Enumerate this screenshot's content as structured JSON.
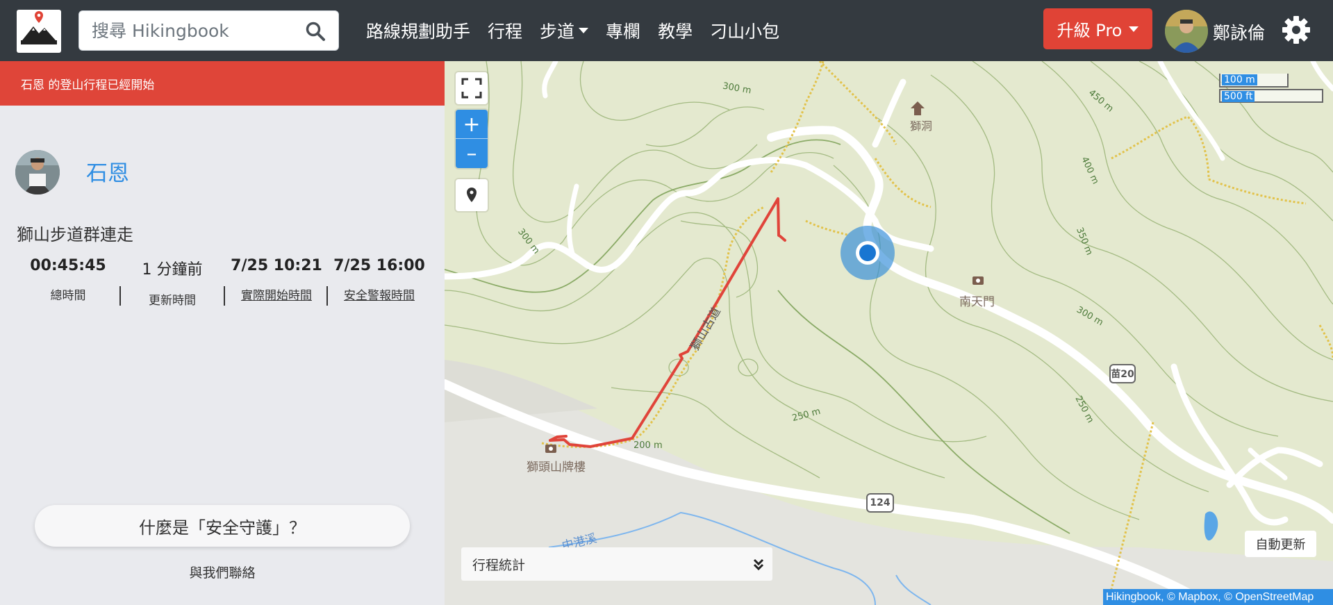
{
  "navbar": {
    "search_placeholder": "搜尋 Hikingbook",
    "links": [
      {
        "label": "路線規劃助手"
      },
      {
        "label": "行程"
      },
      {
        "label": "步道",
        "has_caret": true
      },
      {
        "label": "專欄"
      },
      {
        "label": "教學"
      },
      {
        "label": "刁山小包"
      }
    ],
    "upgrade_label": "升級 Pro",
    "user_name": "鄭詠倫",
    "icons": {
      "search": "search-icon",
      "settings": "gear-icon",
      "logo": "hikingbook-logo"
    }
  },
  "sidebar": {
    "alert_text": "石恩 的登山行程已經開始",
    "hiker_name": "石恩",
    "trail_name": "獅山步道群連走",
    "stats": [
      {
        "value": "00:45:45",
        "label": "總時間",
        "underline": false
      },
      {
        "value": "1 分鐘前",
        "label": "更新時間",
        "underline": false
      },
      {
        "value": "7/25 10:21",
        "label": "實際開始時間",
        "underline": true
      },
      {
        "value": "7/25 16:00",
        "label": "安全警報時間",
        "underline": true
      }
    ],
    "safety_button": "什麼是「安全守護」？",
    "contact_text": "與我們聯絡"
  },
  "map": {
    "zoom_in": "+",
    "zoom_out": "–",
    "scale_metric": "100 m",
    "scale_imperial": "500 ft",
    "auto_refresh": "自動更新",
    "trip_stats": "行程統計",
    "attribution": "Hikingbook, © Mapbox, © OpenStreetMap",
    "poi": {
      "cave": "獅洞",
      "south_gate": "南天門",
      "archway": "獅頭山牌樓",
      "trail": "獅山古道",
      "river": "中港溪"
    },
    "road_shields": {
      "r124": "124",
      "r20": "苗20"
    },
    "contours": {
      "c300a": "300 m",
      "c300b": "300 m",
      "c300c": "300 m",
      "c450": "450 m",
      "c400": "400 m",
      "c350": "350 m",
      "c250a": "250 m",
      "c250b": "250 m",
      "c200": "200 m"
    },
    "colors": {
      "track": "#e0443a",
      "location": "#1976d2",
      "water": "#7eb6ee",
      "accent": "#2f8ee3"
    }
  }
}
